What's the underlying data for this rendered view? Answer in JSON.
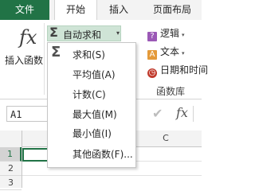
{
  "tabs": {
    "file": "文件",
    "home": "开始",
    "insert": "插入",
    "page_layout": "页面布局"
  },
  "ribbon": {
    "insert_function_icon": "fx",
    "insert_function_label": "插入函数",
    "autosum": {
      "icon": "Σ",
      "label": "自动求和",
      "caret": "▾"
    },
    "categories": [
      {
        "icon": "logic-icon",
        "glyph": "?",
        "label": "逻辑",
        "caret": "▾"
      },
      {
        "icon": "text-icon",
        "glyph": "A",
        "label": "文本",
        "caret": "▾"
      },
      {
        "icon": "date-icon",
        "glyph": "◷",
        "label": "日期和时间"
      }
    ],
    "group_label": "函数库"
  },
  "menu": {
    "sigma_icon": "Σ",
    "items": [
      "求和(S)",
      "平均值(A)",
      "计数(C)",
      "最大值(M)",
      "最小值(I)",
      "其他函数(F)..."
    ]
  },
  "formula_bar": {
    "name_box": "A1",
    "check_icon": "✔",
    "fx_icon": "fx"
  },
  "grid": {
    "col_c": "C",
    "rows": [
      "1",
      "2",
      "3"
    ]
  },
  "colors": {
    "accent": "#217346",
    "highlight": "#cfe4d6"
  }
}
